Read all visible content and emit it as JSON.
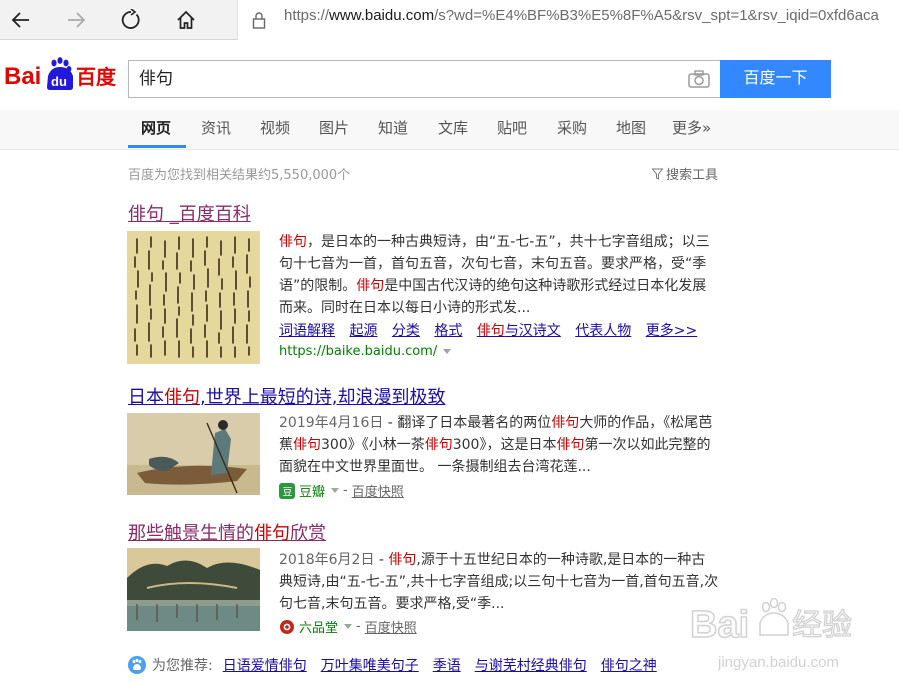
{
  "browser": {
    "url_prefix": "https://",
    "url_host": "www.baidu.com",
    "url_rest": "/s?wd=%E4%BF%B3%E5%8F%A5&rsv_spt=1&rsv_iqid=0xfd6aca"
  },
  "logo": {
    "text_left": "Bai",
    "text_du": "du",
    "text_cn": "百度"
  },
  "search": {
    "query": "俳句",
    "button_label": "百度一下"
  },
  "tabs": [
    {
      "label": "网页",
      "active": true
    },
    {
      "label": "资讯"
    },
    {
      "label": "视频"
    },
    {
      "label": "图片"
    },
    {
      "label": "知道"
    },
    {
      "label": "文库"
    },
    {
      "label": "贴吧"
    },
    {
      "label": "采购"
    },
    {
      "label": "地图"
    },
    {
      "label": "更多»"
    }
  ],
  "result_count": "百度为您找到相关结果约5,550,000个",
  "search_tools": "搜索工具",
  "results": [
    {
      "title_a": "俳句",
      "title_b": "_百度百科",
      "snippet": [
        {
          "em": "俳句",
          "text": "，是日本的一种古典短诗，由“五-七-五”，共十七字音组成；以三句十七音为一首，首句五音，次句七音，末句五音。要求严格，受“季语”的限制。"
        },
        {
          "em": "俳句",
          "text": "是中国古代汉诗的绝句这种诗歌形式经过日本化发展而来。同时在日本以每日小诗的形式发..."
        }
      ],
      "links": [
        "词语解释",
        "起源",
        "分类",
        "格式",
        "与汉诗文",
        "代表人物",
        "更多>>"
      ],
      "links_em": "俳句",
      "source": "https://baike.baidu.com/"
    },
    {
      "title_a": "日本",
      "title_em": "俳句",
      "title_b": ",世界上最短的诗,却浪漫到极致",
      "date": "2019年4月16日",
      "snippet_parts": [
        "翻译了日本最著名的两位",
        "俳句",
        "大师的作品，《松尾芭蕉",
        "俳句",
        "300》《小林一茶",
        "俳句",
        "300》，这是日本",
        "俳句",
        "第一次以如此完整的面貌在中文世界里面世。 一条摄制组去台湾花莲..."
      ],
      "source": "豆瓣",
      "snapshot": "百度快照"
    },
    {
      "title_a": "那些触景生情的",
      "title_em": "俳句",
      "title_b": "欣赏",
      "date": "2018年6月2日",
      "snippet_parts": [
        "俳句",
        ",源于十五世纪日本的一种诗歌,是日本的一种古典短诗,由“五-七-五”,共十七字音组成;以三句十七音为一首,首句五音,次句七音,末句五音。要求严格,受“季..."
      ],
      "source": "六品堂",
      "snapshot": "百度快照"
    }
  ],
  "recommend": {
    "label": "为您推荐:",
    "items": [
      "日语爱情俳句",
      "万叶集唯美句子",
      "季语",
      "与谢芜村经典俳句",
      "俳句之神"
    ]
  },
  "watermark": {
    "brand": "Bai",
    "brand2": "经验",
    "site": "jingyan.baidu.com"
  },
  "colors": {
    "accent": "#3388ff",
    "link": "#1a0dab",
    "visited": "#8a2a6a",
    "em": "#cc0000",
    "source": "#008000"
  }
}
